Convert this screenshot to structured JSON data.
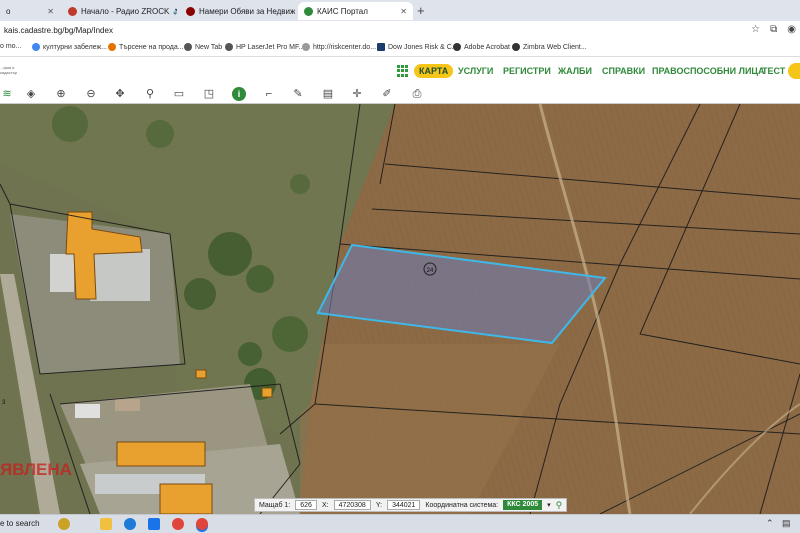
{
  "browser": {
    "tabs": [
      {
        "label": "o",
        "color": "#5f6368"
      },
      {
        "label": "Начало - Радио ZROCK",
        "color": "#c0392b",
        "audio": "🔊"
      },
      {
        "label": "Намери Обяви за Недвижими",
        "color": "#8b0000"
      },
      {
        "label": "КАИС Портал",
        "color": "#2f8a3a",
        "active": true
      }
    ],
    "new_tab": "+",
    "url": "kais.cadastre.bg/bg/Map/Index",
    "bookmarks": [
      {
        "label": "o mo...",
        "color": "#888"
      },
      {
        "label": "културни забележ...",
        "color": "#4285f4"
      },
      {
        "label": "Търсене на прода...",
        "color": "#e37400"
      },
      {
        "label": "New Tab",
        "color": "#555"
      },
      {
        "label": "HP LaserJet Pro MF...",
        "color": "#555"
      },
      {
        "label": "http://riskcenter.do...",
        "color": "#999"
      },
      {
        "label": "Dow Jones Risk & C...",
        "color": "#1a3c6e"
      },
      {
        "label": "Adobe Acrobat",
        "color": "#333"
      },
      {
        "label": "Zimbra Web Client...",
        "color": "#333"
      }
    ]
  },
  "site": {
    "logo_text": "...фия и кадастър",
    "nav": [
      "КАРТА",
      "УСЛУГИ",
      "РЕГИСТРИ",
      "ЖАЛБИ",
      "СПРАВКИ",
      "ПРАВОСПОСОБНИ ЛИЦА",
      "ТЕСТ"
    ]
  },
  "toolbar": {
    "tools": [
      "layers-icon",
      "stack-icon",
      "zoom-in-icon",
      "zoom-out-icon",
      "pan-icon",
      "pin-icon",
      "select-rect-icon",
      "select-icon",
      "info-icon",
      "measure-icon",
      "draw-icon",
      "map-icon",
      "crosshair-icon",
      "edit-icon",
      "print-icon"
    ],
    "info_symbol": "i"
  },
  "map": {
    "parcel_label": "24",
    "scale_label": "Мащаб 1:",
    "scale_value": "626",
    "x_label": "X:",
    "x_value": "4720308",
    "y_label": "Y:",
    "y_value": "344021",
    "crs_label": "Координатна система:",
    "crs_value": "ККС 2005",
    "side_label": "3",
    "watermark": "ЯВЛЕНА",
    "highlight_color": "#3fb8e8",
    "building_color": "#e8a02e"
  },
  "taskbar": {
    "search": "e to search"
  }
}
